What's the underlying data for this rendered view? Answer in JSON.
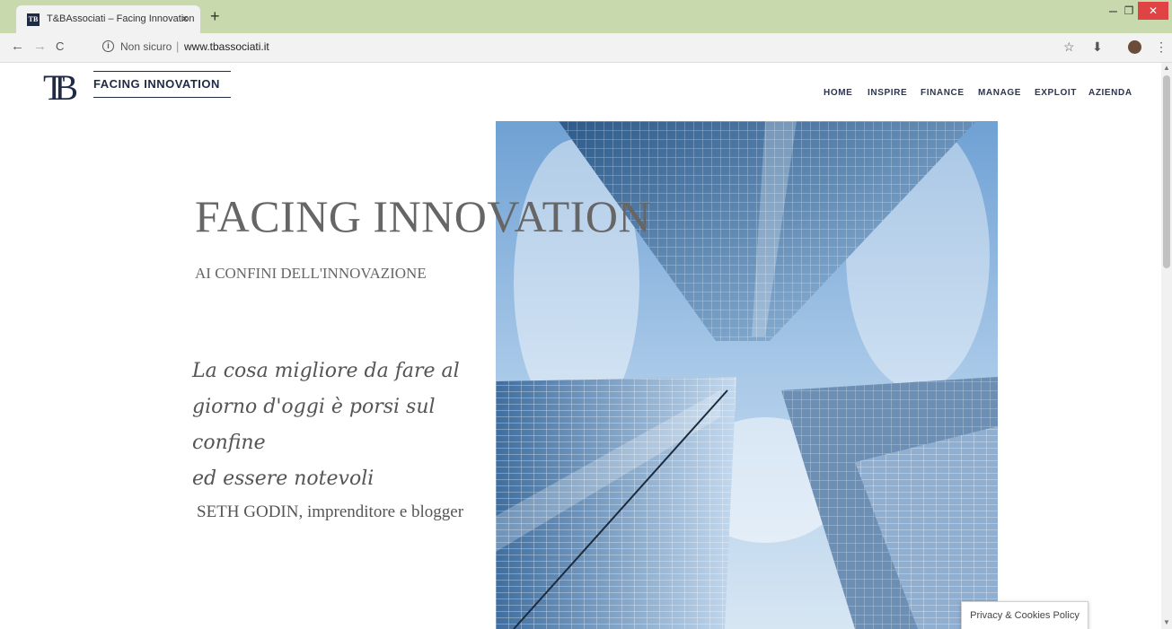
{
  "browser": {
    "tab_title": "T&BAssociati – Facing Innovation",
    "tab_favicon_text": "TB",
    "tab_close": "×",
    "new_tab": "+",
    "window_minimize": "–",
    "window_maximize": "❐",
    "window_close": "✕",
    "nav_back": "←",
    "nav_forward": "→",
    "nav_reload": "C",
    "security_icon": "ⓘ",
    "security_label": "Non sicuro",
    "url_separator": "|",
    "url": "www.tbassociati.it",
    "bookmark_star": "☆",
    "download_icon": "⬇",
    "menu_icon": "⋮"
  },
  "site": {
    "logo_mark": "TB",
    "logo_text": "FACING INNOVATION",
    "nav": [
      "HOME",
      "INSPIRE",
      "FINANCE",
      "MANAGE",
      "EXPLOIT",
      "AZIENDA"
    ]
  },
  "hero": {
    "title": "FACING INNOVATION",
    "subtitle": "AI CONFINI DELL'INNOVAZIONE",
    "quote_line1": "La cosa migliore da fare al",
    "quote_line2": "giorno d'oggi è porsi sul confine",
    "quote_line3": "ed essere notevoli",
    "author": "SETH GODIN, imprenditore e blogger"
  },
  "cookie_policy": "Privacy & Cookies Policy",
  "colors": {
    "titlebar": "#c8d9ae",
    "brand_navy": "#1f2a44",
    "close_red": "#e04343"
  }
}
